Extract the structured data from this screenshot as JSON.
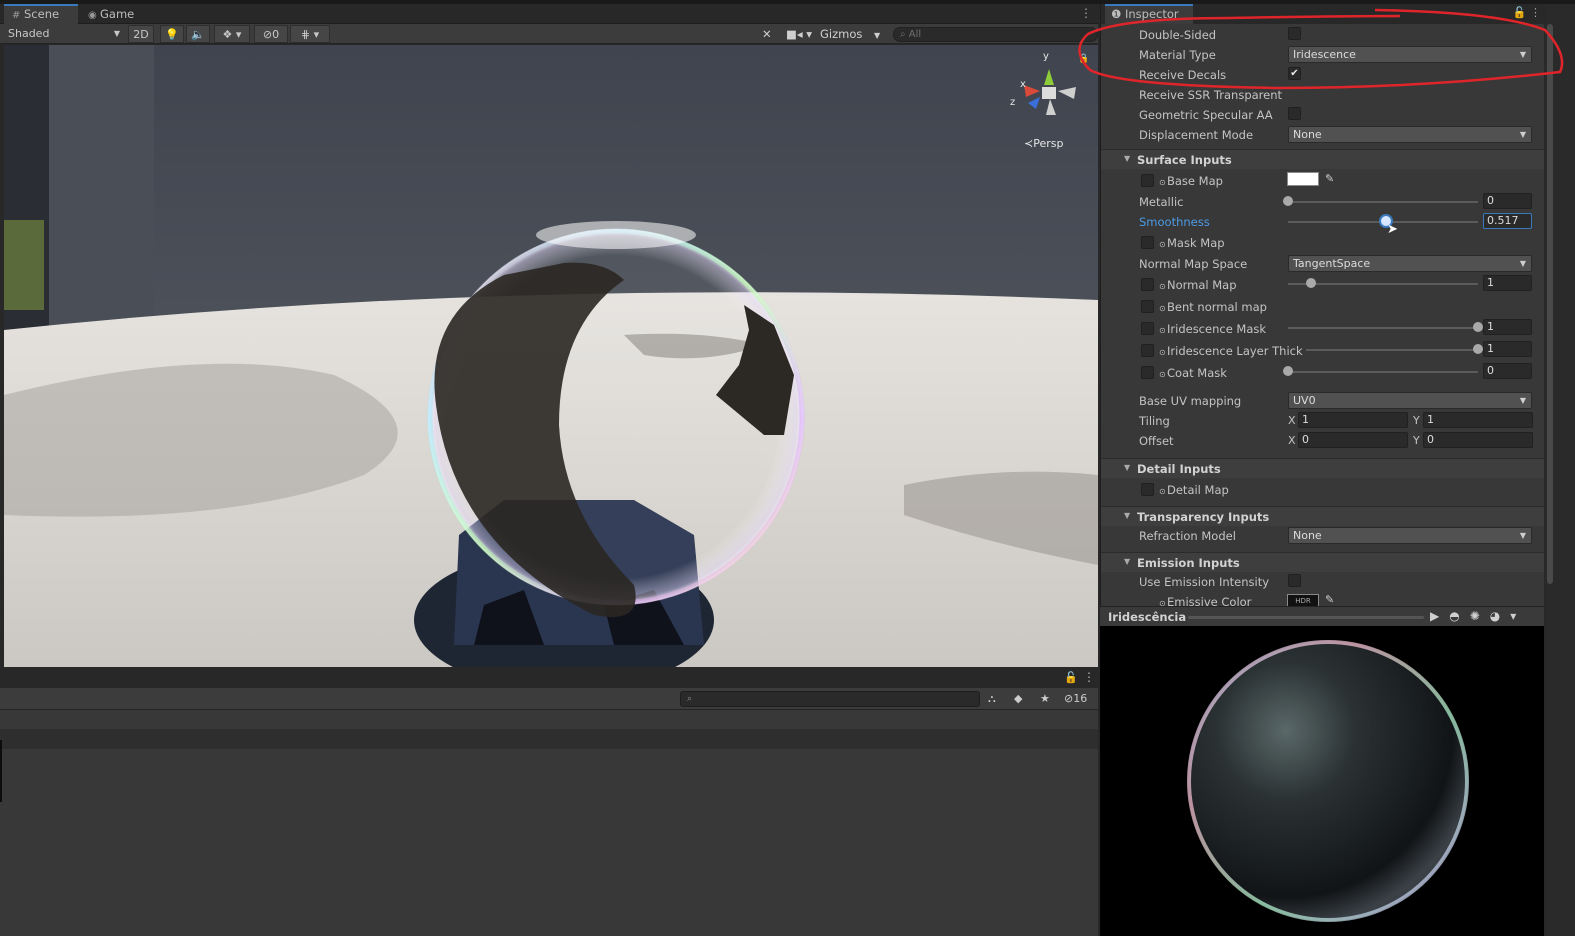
{
  "scene_panel": {
    "tabs": [
      {
        "label": "Scene",
        "icon": "grid-icon"
      },
      {
        "label": "Game",
        "icon": "gamepad-icon"
      }
    ],
    "toolbar": {
      "draw_mode": "Shaded",
      "toggle_2d": "2D",
      "hidden_count": "0",
      "gizmos_label": "Gizmos",
      "search_placeholder": "All"
    },
    "orientation_label": "Persp",
    "gizmo_axes": [
      "y",
      "x",
      "z"
    ]
  },
  "bottom_panel": {
    "hidden_count": "16"
  },
  "inspector": {
    "tab_label": "Inspector",
    "properties": {
      "double_sided": {
        "label": "Double-Sided",
        "checked": false
      },
      "material_type": {
        "label": "Material Type",
        "value": "Iridescence"
      },
      "receive_decals": {
        "label": "Receive Decals",
        "checked": true
      },
      "receive_ssr": {
        "label": "Receive SSR Transparent"
      },
      "geometric_specular_aa": {
        "label": "Geometric Specular AA",
        "checked": false
      },
      "displacement_mode": {
        "label": "Displacement Mode",
        "value": "None"
      }
    },
    "surface_inputs": {
      "title": "Surface Inputs",
      "base_map": {
        "label": "Base Map",
        "color": "#ffffff"
      },
      "metallic": {
        "label": "Metallic",
        "value": "0",
        "fraction": 0
      },
      "smoothness": {
        "label": "Smoothness",
        "value": "0.517",
        "fraction": 0.517
      },
      "mask_map": {
        "label": "Mask Map"
      },
      "normal_map_space": {
        "label": "Normal Map Space",
        "value": "TangentSpace"
      },
      "normal_map": {
        "label": "Normal Map",
        "value": "1",
        "fraction": 0.12
      },
      "bent_normal_map": {
        "label": "Bent normal map"
      },
      "iridescence_mask": {
        "label": "Iridescence Mask",
        "value": "1",
        "fraction": 1
      },
      "iridescence_layer_thickness": {
        "label": "Iridescence Layer Thick",
        "value": "1",
        "fraction": 1
      },
      "coat_mask": {
        "label": "Coat Mask",
        "value": "0",
        "fraction": 0
      },
      "base_uv_mapping": {
        "label": "Base UV mapping",
        "value": "UV0"
      },
      "tiling": {
        "label": "Tiling",
        "x_label": "X",
        "x": "1",
        "y_label": "Y",
        "y": "1"
      },
      "offset": {
        "label": "Offset",
        "x_label": "X",
        "x": "0",
        "y_label": "Y",
        "y": "0"
      }
    },
    "detail_inputs": {
      "title": "Detail Inputs",
      "detail_map": {
        "label": "Detail Map"
      }
    },
    "transparency_inputs": {
      "title": "Transparency Inputs",
      "refraction_model": {
        "label": "Refraction Model",
        "value": "None"
      }
    },
    "emission_inputs": {
      "title": "Emission Inputs",
      "use_emission_intensity": {
        "label": "Use Emission Intensity",
        "checked": false
      },
      "emissive_color": {
        "label": "Emissive Color",
        "badge": "HDR"
      }
    }
  },
  "preview": {
    "title": "Iridescência"
  },
  "colors": {
    "accent": "#3a79bb",
    "panel": "#383838",
    "annotation": "#e0252a"
  }
}
